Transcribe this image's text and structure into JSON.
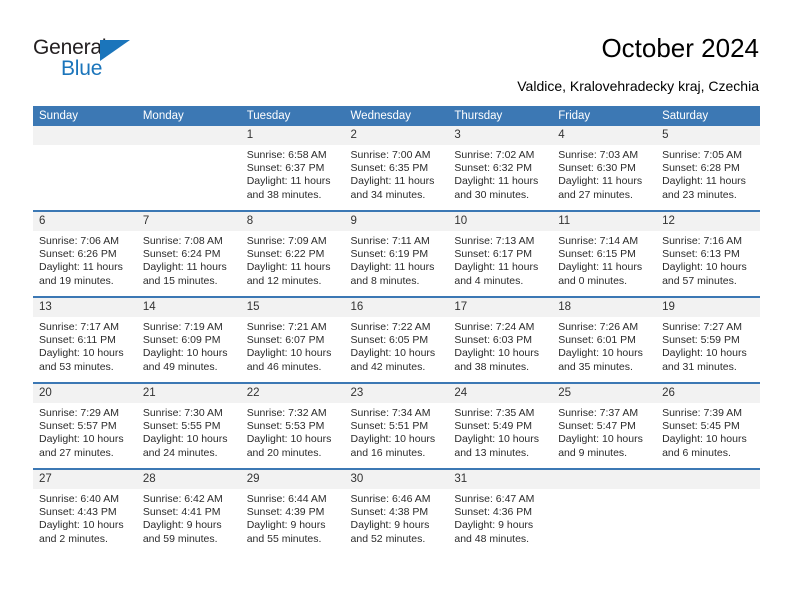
{
  "brand": {
    "name_part1": "General",
    "name_part2": "Blue",
    "accent_color": "#1b75bb"
  },
  "header": {
    "title": "October 2024",
    "location": "Valdice, Kralovehradecky kraj, Czechia",
    "header_bg": "#3c78b4",
    "daynum_bg": "#f2f2f2"
  },
  "calendar": {
    "weekday_headers": [
      "Sunday",
      "Monday",
      "Tuesday",
      "Wednesday",
      "Thursday",
      "Friday",
      "Saturday"
    ],
    "weeks": [
      [
        {
          "day": "",
          "sunrise": "",
          "sunset": "",
          "daylight": ""
        },
        {
          "day": "",
          "sunrise": "",
          "sunset": "",
          "daylight": ""
        },
        {
          "day": "1",
          "sunrise": "Sunrise: 6:58 AM",
          "sunset": "Sunset: 6:37 PM",
          "daylight": "Daylight: 11 hours and 38 minutes."
        },
        {
          "day": "2",
          "sunrise": "Sunrise: 7:00 AM",
          "sunset": "Sunset: 6:35 PM",
          "daylight": "Daylight: 11 hours and 34 minutes."
        },
        {
          "day": "3",
          "sunrise": "Sunrise: 7:02 AM",
          "sunset": "Sunset: 6:32 PM",
          "daylight": "Daylight: 11 hours and 30 minutes."
        },
        {
          "day": "4",
          "sunrise": "Sunrise: 7:03 AM",
          "sunset": "Sunset: 6:30 PM",
          "daylight": "Daylight: 11 hours and 27 minutes."
        },
        {
          "day": "5",
          "sunrise": "Sunrise: 7:05 AM",
          "sunset": "Sunset: 6:28 PM",
          "daylight": "Daylight: 11 hours and 23 minutes."
        }
      ],
      [
        {
          "day": "6",
          "sunrise": "Sunrise: 7:06 AM",
          "sunset": "Sunset: 6:26 PM",
          "daylight": "Daylight: 11 hours and 19 minutes."
        },
        {
          "day": "7",
          "sunrise": "Sunrise: 7:08 AM",
          "sunset": "Sunset: 6:24 PM",
          "daylight": "Daylight: 11 hours and 15 minutes."
        },
        {
          "day": "8",
          "sunrise": "Sunrise: 7:09 AM",
          "sunset": "Sunset: 6:22 PM",
          "daylight": "Daylight: 11 hours and 12 minutes."
        },
        {
          "day": "9",
          "sunrise": "Sunrise: 7:11 AM",
          "sunset": "Sunset: 6:19 PM",
          "daylight": "Daylight: 11 hours and 8 minutes."
        },
        {
          "day": "10",
          "sunrise": "Sunrise: 7:13 AM",
          "sunset": "Sunset: 6:17 PM",
          "daylight": "Daylight: 11 hours and 4 minutes."
        },
        {
          "day": "11",
          "sunrise": "Sunrise: 7:14 AM",
          "sunset": "Sunset: 6:15 PM",
          "daylight": "Daylight: 11 hours and 0 minutes."
        },
        {
          "day": "12",
          "sunrise": "Sunrise: 7:16 AM",
          "sunset": "Sunset: 6:13 PM",
          "daylight": "Daylight: 10 hours and 57 minutes."
        }
      ],
      [
        {
          "day": "13",
          "sunrise": "Sunrise: 7:17 AM",
          "sunset": "Sunset: 6:11 PM",
          "daylight": "Daylight: 10 hours and 53 minutes."
        },
        {
          "day": "14",
          "sunrise": "Sunrise: 7:19 AM",
          "sunset": "Sunset: 6:09 PM",
          "daylight": "Daylight: 10 hours and 49 minutes."
        },
        {
          "day": "15",
          "sunrise": "Sunrise: 7:21 AM",
          "sunset": "Sunset: 6:07 PM",
          "daylight": "Daylight: 10 hours and 46 minutes."
        },
        {
          "day": "16",
          "sunrise": "Sunrise: 7:22 AM",
          "sunset": "Sunset: 6:05 PM",
          "daylight": "Daylight: 10 hours and 42 minutes."
        },
        {
          "day": "17",
          "sunrise": "Sunrise: 7:24 AM",
          "sunset": "Sunset: 6:03 PM",
          "daylight": "Daylight: 10 hours and 38 minutes."
        },
        {
          "day": "18",
          "sunrise": "Sunrise: 7:26 AM",
          "sunset": "Sunset: 6:01 PM",
          "daylight": "Daylight: 10 hours and 35 minutes."
        },
        {
          "day": "19",
          "sunrise": "Sunrise: 7:27 AM",
          "sunset": "Sunset: 5:59 PM",
          "daylight": "Daylight: 10 hours and 31 minutes."
        }
      ],
      [
        {
          "day": "20",
          "sunrise": "Sunrise: 7:29 AM",
          "sunset": "Sunset: 5:57 PM",
          "daylight": "Daylight: 10 hours and 27 minutes."
        },
        {
          "day": "21",
          "sunrise": "Sunrise: 7:30 AM",
          "sunset": "Sunset: 5:55 PM",
          "daylight": "Daylight: 10 hours and 24 minutes."
        },
        {
          "day": "22",
          "sunrise": "Sunrise: 7:32 AM",
          "sunset": "Sunset: 5:53 PM",
          "daylight": "Daylight: 10 hours and 20 minutes."
        },
        {
          "day": "23",
          "sunrise": "Sunrise: 7:34 AM",
          "sunset": "Sunset: 5:51 PM",
          "daylight": "Daylight: 10 hours and 16 minutes."
        },
        {
          "day": "24",
          "sunrise": "Sunrise: 7:35 AM",
          "sunset": "Sunset: 5:49 PM",
          "daylight": "Daylight: 10 hours and 13 minutes."
        },
        {
          "day": "25",
          "sunrise": "Sunrise: 7:37 AM",
          "sunset": "Sunset: 5:47 PM",
          "daylight": "Daylight: 10 hours and 9 minutes."
        },
        {
          "day": "26",
          "sunrise": "Sunrise: 7:39 AM",
          "sunset": "Sunset: 5:45 PM",
          "daylight": "Daylight: 10 hours and 6 minutes."
        }
      ],
      [
        {
          "day": "27",
          "sunrise": "Sunrise: 6:40 AM",
          "sunset": "Sunset: 4:43 PM",
          "daylight": "Daylight: 10 hours and 2 minutes."
        },
        {
          "day": "28",
          "sunrise": "Sunrise: 6:42 AM",
          "sunset": "Sunset: 4:41 PM",
          "daylight": "Daylight: 9 hours and 59 minutes."
        },
        {
          "day": "29",
          "sunrise": "Sunrise: 6:44 AM",
          "sunset": "Sunset: 4:39 PM",
          "daylight": "Daylight: 9 hours and 55 minutes."
        },
        {
          "day": "30",
          "sunrise": "Sunrise: 6:46 AM",
          "sunset": "Sunset: 4:38 PM",
          "daylight": "Daylight: 9 hours and 52 minutes."
        },
        {
          "day": "31",
          "sunrise": "Sunrise: 6:47 AM",
          "sunset": "Sunset: 4:36 PM",
          "daylight": "Daylight: 9 hours and 48 minutes."
        },
        {
          "day": "",
          "sunrise": "",
          "sunset": "",
          "daylight": ""
        },
        {
          "day": "",
          "sunrise": "",
          "sunset": "",
          "daylight": ""
        }
      ]
    ]
  }
}
